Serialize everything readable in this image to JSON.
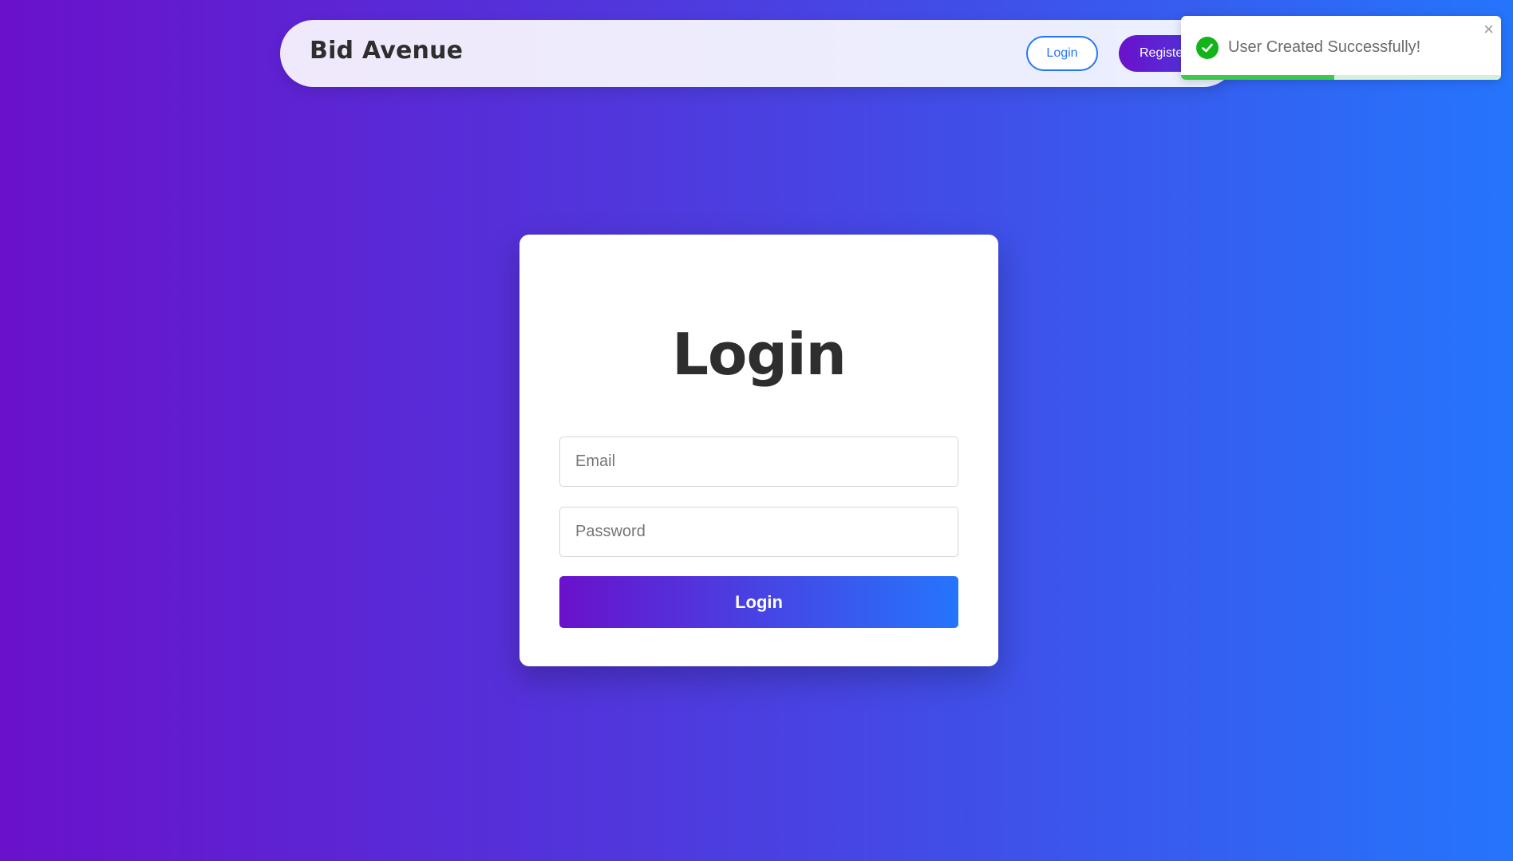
{
  "navbar": {
    "brand": "Bid Avenue",
    "login_label": "Login",
    "register_label": "Register"
  },
  "toast": {
    "message": "User Created Successfully!",
    "icon": "check-circle-icon",
    "close_icon": "close-icon",
    "close_glyph": "×",
    "progress": 0.48,
    "accent": "#11b519"
  },
  "login_card": {
    "title": "Login",
    "email_placeholder": "Email",
    "password_placeholder": "Password",
    "submit_label": "Login"
  },
  "colors": {
    "gradient_start": "#6a11cb",
    "gradient_end": "#2575fc",
    "text_dark": "#2e2e2e"
  }
}
